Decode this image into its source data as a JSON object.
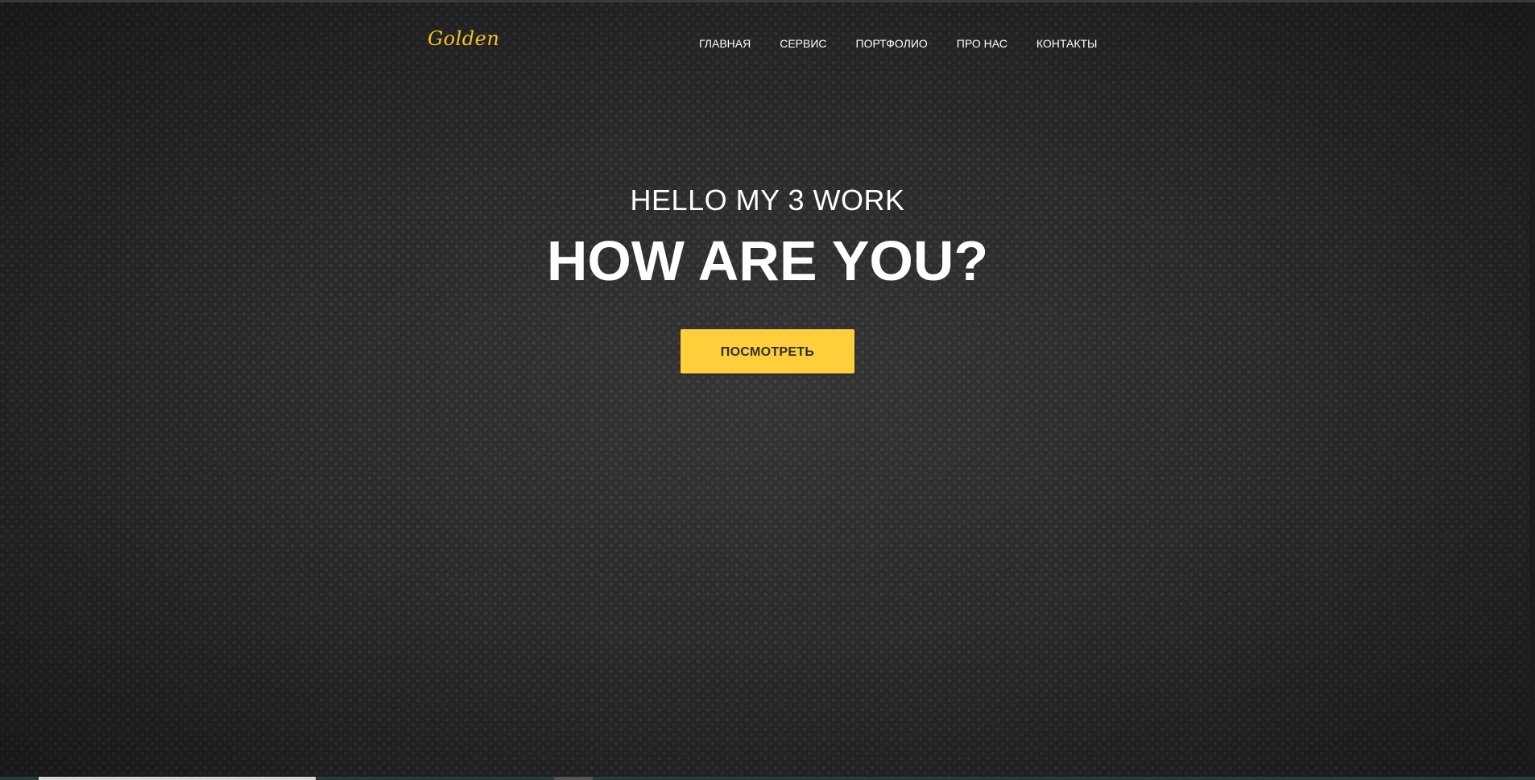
{
  "header": {
    "logo_text": "Golden",
    "nav": [
      "ГЛАВНАЯ",
      "СЕРВИС",
      "ПОРТФОЛИО",
      "ПРО НАС",
      "КОНТАКТЫ"
    ]
  },
  "hero": {
    "subtitle": "HELLO MY 3 WORK",
    "title": "HOW ARE YOU?",
    "button_label": "ПОСМОТРЕТЬ"
  },
  "colors": {
    "accent": "#fecf3b",
    "logo": "#f5c227",
    "background": "#2b2b2b",
    "text": "#ffffff"
  }
}
